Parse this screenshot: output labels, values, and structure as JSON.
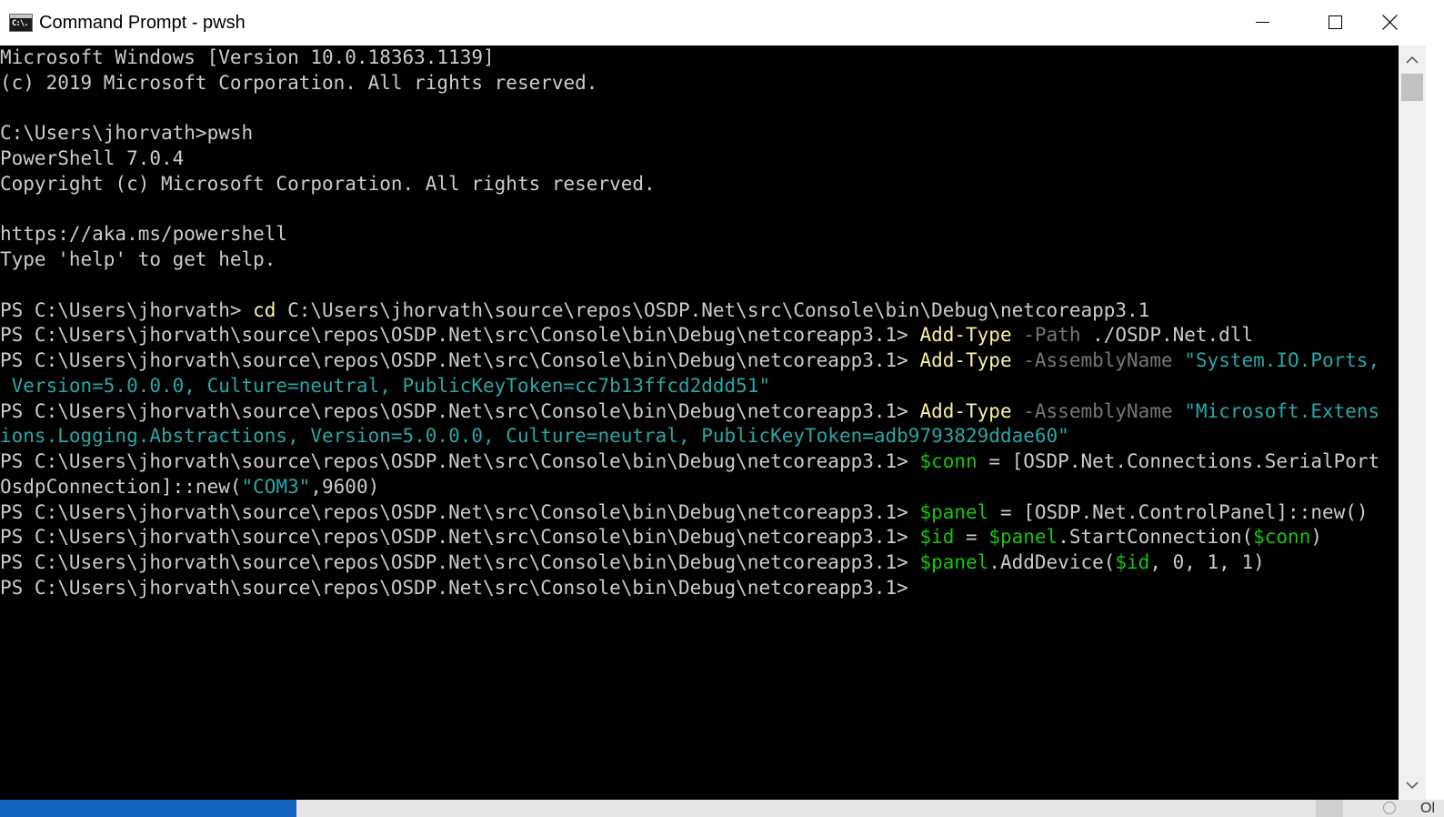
{
  "window": {
    "title": "Command Prompt - pwsh",
    "icon_label": "C:\\."
  },
  "colors": {
    "titlebar_bg": "#ffffff",
    "console_bg": "#000000",
    "default_text": "#cccccc",
    "command": "#f9f1a5",
    "parameter": "#767676",
    "string": "#3a96dd",
    "variable": "#16c60c",
    "taskbar_active": "#1565c0"
  },
  "console": {
    "lines": [
      [
        {
          "text": "Microsoft Windows [Version 10.0.18363.1139]",
          "style": "default"
        }
      ],
      [
        {
          "text": "(c) 2019 Microsoft Corporation. All rights reserved.",
          "style": "default"
        }
      ],
      [
        {
          "text": "",
          "style": "default"
        }
      ],
      [
        {
          "text": "C:\\Users\\jhorvath>pwsh",
          "style": "default"
        }
      ],
      [
        {
          "text": "PowerShell 7.0.4",
          "style": "default"
        }
      ],
      [
        {
          "text": "Copyright (c) Microsoft Corporation. All rights reserved.",
          "style": "default"
        }
      ],
      [
        {
          "text": "",
          "style": "default"
        }
      ],
      [
        {
          "text": "https://aka.ms/powershell",
          "style": "default"
        }
      ],
      [
        {
          "text": "Type 'help' to get help.",
          "style": "default"
        }
      ],
      [
        {
          "text": "",
          "style": "default"
        }
      ],
      [
        {
          "text": "PS C:\\Users\\jhorvath> ",
          "style": "default"
        },
        {
          "text": "cd",
          "style": "cmd"
        },
        {
          "text": " C:\\Users\\jhorvath\\source\\repos\\OSDP.Net\\src\\Console\\bin\\Debug\\netcoreapp3.1",
          "style": "default"
        }
      ],
      [
        {
          "text": "PS C:\\Users\\jhorvath\\source\\repos\\OSDP.Net\\src\\Console\\bin\\Debug\\netcoreapp3.1> ",
          "style": "default"
        },
        {
          "text": "Add-Type",
          "style": "cmd"
        },
        {
          "text": " -Path",
          "style": "param"
        },
        {
          "text": " ./OSDP.Net.dll",
          "style": "default"
        }
      ],
      [
        {
          "text": "PS C:\\Users\\jhorvath\\source\\repos\\OSDP.Net\\src\\Console\\bin\\Debug\\netcoreapp3.1> ",
          "style": "default"
        },
        {
          "text": "Add-Type",
          "style": "cmd"
        },
        {
          "text": " -AssemblyName",
          "style": "param"
        },
        {
          "text": " \"System.IO.Ports,",
          "style": "string-cyan"
        }
      ],
      [
        {
          "text": " Version=5.0.0.0, Culture=neutral, PublicKeyToken=cc7b13ffcd2ddd51\"",
          "style": "string-cyan"
        }
      ],
      [
        {
          "text": "PS C:\\Users\\jhorvath\\source\\repos\\OSDP.Net\\src\\Console\\bin\\Debug\\netcoreapp3.1> ",
          "style": "default"
        },
        {
          "text": "Add-Type",
          "style": "cmd"
        },
        {
          "text": " -AssemblyName",
          "style": "param"
        },
        {
          "text": " \"Microsoft.Extens",
          "style": "string-cyan"
        }
      ],
      [
        {
          "text": "ions.Logging.Abstractions, Version=5.0.0.0, Culture=neutral, PublicKeyToken=adb9793829ddae60\"",
          "style": "string-cyan"
        }
      ],
      [
        {
          "text": "PS C:\\Users\\jhorvath\\source\\repos\\OSDP.Net\\src\\Console\\bin\\Debug\\netcoreapp3.1> ",
          "style": "default"
        },
        {
          "text": "$conn",
          "style": "var"
        },
        {
          "text": " = [OSDP.Net.Connections.SerialPort",
          "style": "default"
        }
      ],
      [
        {
          "text": "OsdpConnection]::new(",
          "style": "default"
        },
        {
          "text": "\"COM3\"",
          "style": "string-cyan"
        },
        {
          "text": ",9600)",
          "style": "default"
        }
      ],
      [
        {
          "text": "PS C:\\Users\\jhorvath\\source\\repos\\OSDP.Net\\src\\Console\\bin\\Debug\\netcoreapp3.1> ",
          "style": "default"
        },
        {
          "text": "$panel",
          "style": "var"
        },
        {
          "text": " = [OSDP.Net.ControlPanel]::new()",
          "style": "default"
        }
      ],
      [
        {
          "text": "PS C:\\Users\\jhorvath\\source\\repos\\OSDP.Net\\src\\Console\\bin\\Debug\\netcoreapp3.1> ",
          "style": "default"
        },
        {
          "text": "$id",
          "style": "var"
        },
        {
          "text": " = ",
          "style": "default"
        },
        {
          "text": "$panel",
          "style": "var"
        },
        {
          "text": ".StartConnection(",
          "style": "default"
        },
        {
          "text": "$conn",
          "style": "var"
        },
        {
          "text": ")",
          "style": "default"
        }
      ],
      [
        {
          "text": "PS C:\\Users\\jhorvath\\source\\repos\\OSDP.Net\\src\\Console\\bin\\Debug\\netcoreapp3.1> ",
          "style": "default"
        },
        {
          "text": "$panel",
          "style": "var"
        },
        {
          "text": ".AddDevice(",
          "style": "default"
        },
        {
          "text": "$id",
          "style": "var"
        },
        {
          "text": ", 0, 1, 1)",
          "style": "default"
        }
      ],
      [
        {
          "text": "PS C:\\Users\\jhorvath\\source\\repos\\OSDP.Net\\src\\Console\\bin\\Debug\\netcoreapp3.1>",
          "style": "default"
        }
      ]
    ]
  },
  "scrollbar": {
    "up_icon": "chevron-up-icon",
    "down_icon": "chevron-down-icon"
  },
  "taskbar": {
    "label": "Ol"
  }
}
